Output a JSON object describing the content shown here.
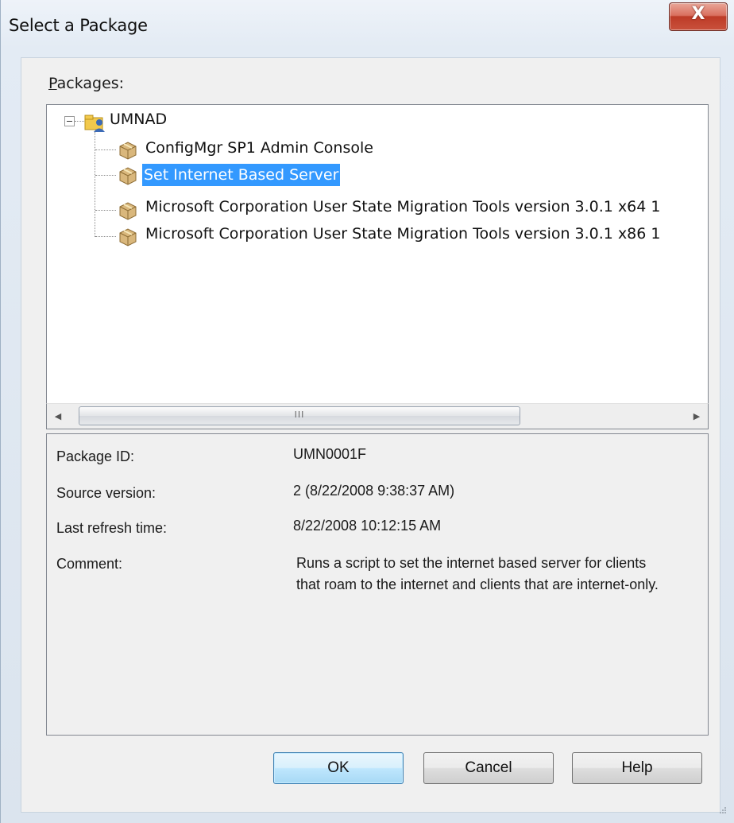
{
  "window": {
    "title": "Select a Package",
    "close_glyph": "X"
  },
  "packages_label": {
    "mnemonic": "P",
    "rest": "ackages:"
  },
  "tree": {
    "root": {
      "label": "UMNAD",
      "icon": "site-server-icon",
      "expanded": true
    },
    "children": [
      {
        "label": "ConfigMgr SP1 Admin Console",
        "icon": "package-icon",
        "selected": false
      },
      {
        "label": "Set Internet Based Server",
        "icon": "package-icon",
        "selected": true
      },
      {
        "label": "Microsoft Corporation User State Migration Tools version 3.0.1 x64 1",
        "icon": "package-icon",
        "selected": false
      },
      {
        "label": "Microsoft Corporation User State Migration Tools version 3.0.1 x86 1",
        "icon": "package-icon",
        "selected": false
      }
    ],
    "scrollbar": {
      "left_arrow": "◀",
      "right_arrow": "▶",
      "thumb_grip": "III"
    }
  },
  "details": {
    "package_id": {
      "label": "Package ID:",
      "value": "UMN0001F"
    },
    "source_version": {
      "label": "Source version:",
      "value": "2 (8/22/2008 9:38:37 AM)"
    },
    "last_refresh": {
      "label": "Last refresh time:",
      "value": "8/22/2008 10:12:15 AM"
    },
    "comment": {
      "label": "Comment:",
      "value": "Runs a script to set the internet based server for clients that roam to the internet and clients that are internet-only."
    }
  },
  "buttons": {
    "ok": "OK",
    "cancel": "Cancel",
    "help": "Help"
  },
  "colors": {
    "selection": "#3399ff",
    "close_button": "#c9513c",
    "default_button": "#bee6fd"
  }
}
